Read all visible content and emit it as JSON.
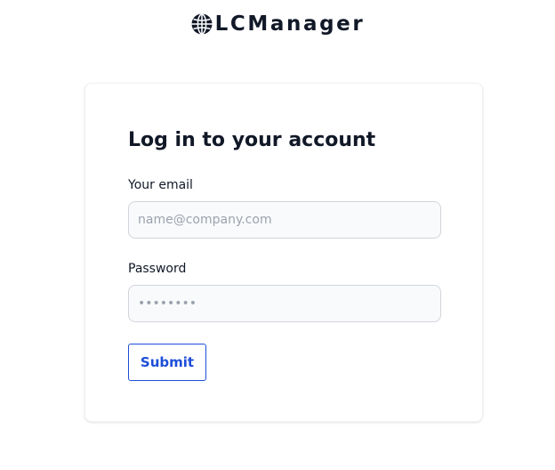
{
  "brand": {
    "name": "LCManager",
    "icon": "globe-icon"
  },
  "login": {
    "title": "Log in to your account",
    "email_label": "Your email",
    "email_placeholder": "name@company.com",
    "email_value": "",
    "password_label": "Password",
    "password_placeholder": "••••••••",
    "password_value": "",
    "submit_label": "Submit"
  },
  "colors": {
    "text": "#111827",
    "accent": "#1d4ed8",
    "field_bg": "#f9fafb",
    "field_border": "#d1d5db",
    "placeholder": "#9ca3af"
  }
}
